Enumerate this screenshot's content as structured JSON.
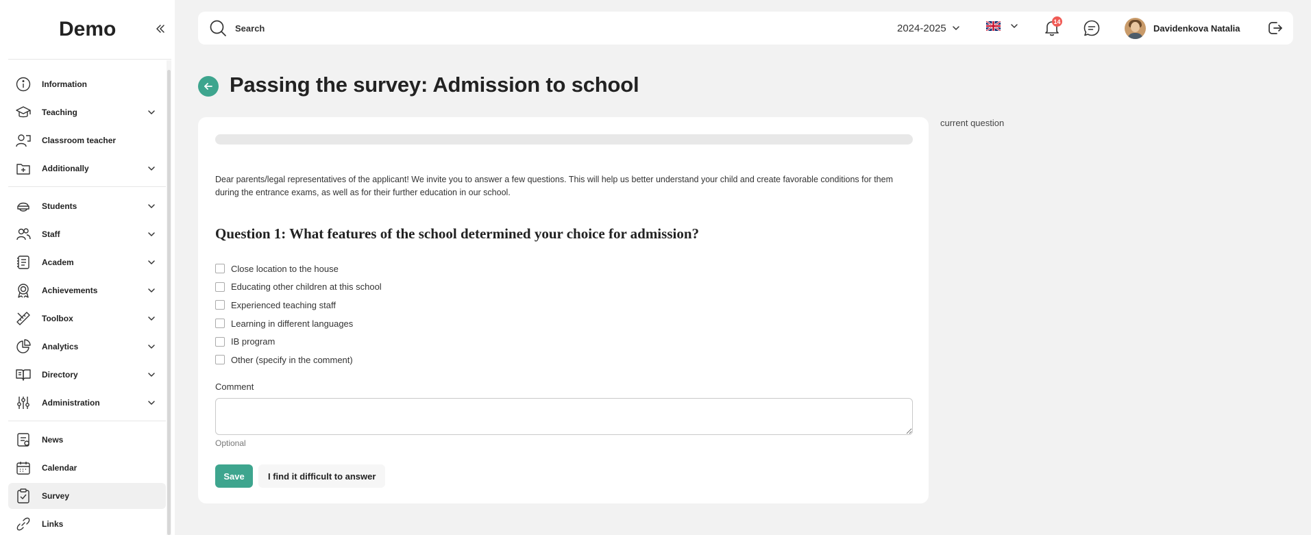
{
  "sidebar": {
    "brand": "Demo",
    "items": [
      {
        "label": "Information",
        "icon": "info-circle-icon"
      },
      {
        "label": "Teaching",
        "icon": "graduation-cap-icon"
      },
      {
        "label": "Classroom teacher",
        "icon": "user-chalkboard-icon"
      },
      {
        "label": "Additionally",
        "icon": "folder-plus-icon"
      },
      {
        "label": "Students",
        "icon": "student-cap-icon"
      },
      {
        "label": "Staff",
        "icon": "users-icon"
      },
      {
        "label": "Academ",
        "icon": "book-list-icon"
      },
      {
        "label": "Achievements",
        "icon": "award-icon"
      },
      {
        "label": "Toolbox",
        "icon": "ruler-pencil-icon"
      },
      {
        "label": "Analytics",
        "icon": "pie-chart-icon"
      },
      {
        "label": "Directory",
        "icon": "open-book-icon"
      },
      {
        "label": "Administration",
        "icon": "sliders-icon"
      },
      {
        "label": "News",
        "icon": "news-icon"
      },
      {
        "label": "Calendar",
        "icon": "calendar-icon"
      },
      {
        "label": "Survey",
        "icon": "clipboard-check-icon"
      },
      {
        "label": "Links",
        "icon": "link-icon"
      }
    ]
  },
  "topbar": {
    "search_placeholder": "Search",
    "year": "2024-2025",
    "language_flag": "uk-flag-icon",
    "notifications_count": "14",
    "user_name": "Davidenkova Natalia"
  },
  "page": {
    "title": "Passing the survey: Admission to school",
    "side_note": "current question"
  },
  "survey": {
    "progress": 0,
    "intro": "Dear parents/legal representatives of the applicant! We invite you to answer a few questions. This will help us better understand your child and create favorable conditions for them during the entrance exams, as well as for their further education in our school.",
    "question": "Question 1: What features of the school determined your choice for admission?",
    "options": [
      "Close location to the house",
      "Educating other children at this school",
      "Experienced teaching staff",
      "Learning in different languages",
      "IB program",
      "Other (specify in the comment)"
    ],
    "comment_label": "Comment",
    "comment_value": "",
    "comment_hint": "Optional",
    "save_label": "Save",
    "skip_label": "I find it difficult to answer"
  },
  "colors": {
    "accent": "#3ea58e",
    "badge": "#f05a54",
    "background": "#f2f2f2"
  }
}
